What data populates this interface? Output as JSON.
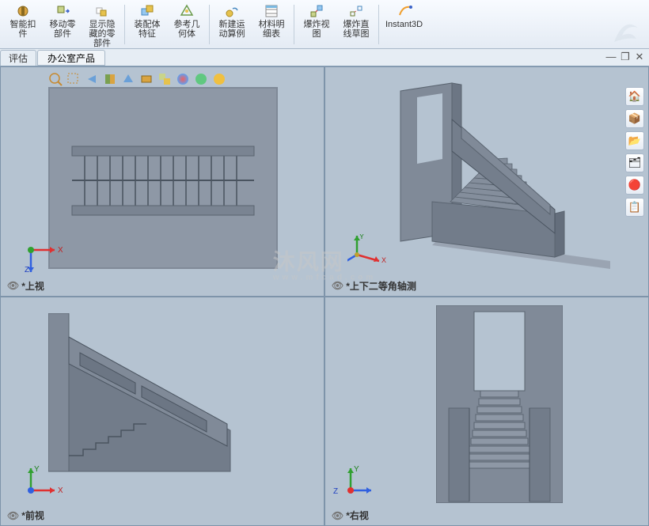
{
  "ribbon": {
    "btns": [
      {
        "label": "智能扣\n件"
      },
      {
        "label": "移动零\n部件"
      },
      {
        "label": "显示隐\n藏的零\n部件"
      },
      {
        "label": "装配体\n特征"
      },
      {
        "label": "参考几\n何体"
      },
      {
        "label": "新建运\n动算例"
      },
      {
        "label": "材料明\n细表"
      },
      {
        "label": "爆炸视\n图"
      },
      {
        "label": "爆炸直\n线草图"
      },
      {
        "label": "Instant3D"
      }
    ]
  },
  "tabs": {
    "eval": "评估",
    "panel": "办公室产品"
  },
  "viewports": {
    "top": "*上视",
    "iso": "*上下二等角轴测",
    "front": "*前视",
    "right": "*右视"
  },
  "triad_axes": {
    "x": "X",
    "y": "Y",
    "z": "Z"
  },
  "watermark": {
    "main": "沐风网",
    "sub": "www.mfcad.com"
  }
}
